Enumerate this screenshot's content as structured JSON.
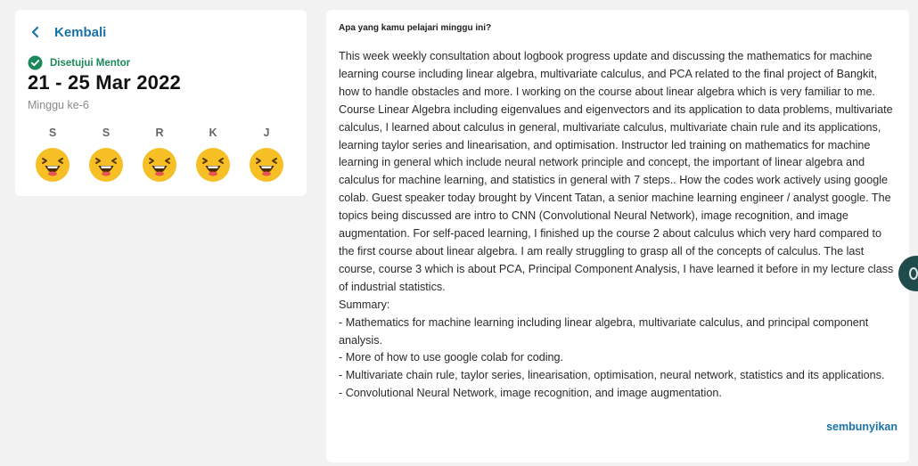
{
  "header": {
    "back_label": "Kembali",
    "status_label": "Disetujui Mentor",
    "date_range": "21 - 25 Mar 2022",
    "week_label": "Minggu ke-6"
  },
  "days": [
    {
      "letter": "S",
      "mood_icon": "happy-grin-emoji"
    },
    {
      "letter": "S",
      "mood_icon": "happy-grin-emoji"
    },
    {
      "letter": "R",
      "mood_icon": "happy-grin-emoji"
    },
    {
      "letter": "K",
      "mood_icon": "happy-grin-emoji"
    },
    {
      "letter": "J",
      "mood_icon": "happy-grin-emoji"
    }
  ],
  "journal": {
    "question": "Apa yang kamu pelajari minggu ini?",
    "answer": "This week weekly consultation about logbook progress update and discussing the mathematics for machine learning course including linear algebra, multivariate calculus, and PCA related to the final project of Bangkit, how to handle obstacles and more. I working on the course about linear algebra which is very familiar to me. Course Linear Algebra including eigenvalues and eigenvectors and its application to data problems, multivariate calculus, I learned about calculus in general, multivariate calculus, multivariate chain rule and its applications, learning taylor series and linearisation, and optimisation. Instructor led training on mathematics for machine learning in general which include neural network principle and concept, the important of linear algebra and calculus for machine learning, and statistics in general with 7 steps.. How the codes work actively using google colab. Guest speaker today brought by Vincent Tatan, a senior machine learning engineer / analyst google. The topics being discussed are intro to CNN (Convolutional Neural Network), image recognition, and image augmentation. For self-paced learning, I finished up the course 2 about calculus which very hard compared to the first course about linear algebra. I am really struggling to grasp all of the concepts of calculus. The last course, course 3 which is about PCA, Principal Component Analysis, I have learned it before in my lecture class of industrial statistics.\nSummary:\n-    Mathematics for machine learning including linear algebra, multivariate calculus, and principal component analysis.\n-    More of how to use google colab for coding.\n-    Multivariate chain rule, taylor series, linearisation, optimisation, neural network, statistics and its applications.\n-    Convolutional Neural Network, image recognition, and image augmentation.",
    "hide_label": "sembunyikan"
  },
  "colors": {
    "accent": "#1a73a8",
    "approved": "#1b8a5a",
    "emoji_face": "#f6bf26",
    "floating_button": "#1f4b4a"
  },
  "icons": {
    "back": "chevron-left-icon",
    "status": "check-circle-icon",
    "floating": "chat-icon"
  }
}
